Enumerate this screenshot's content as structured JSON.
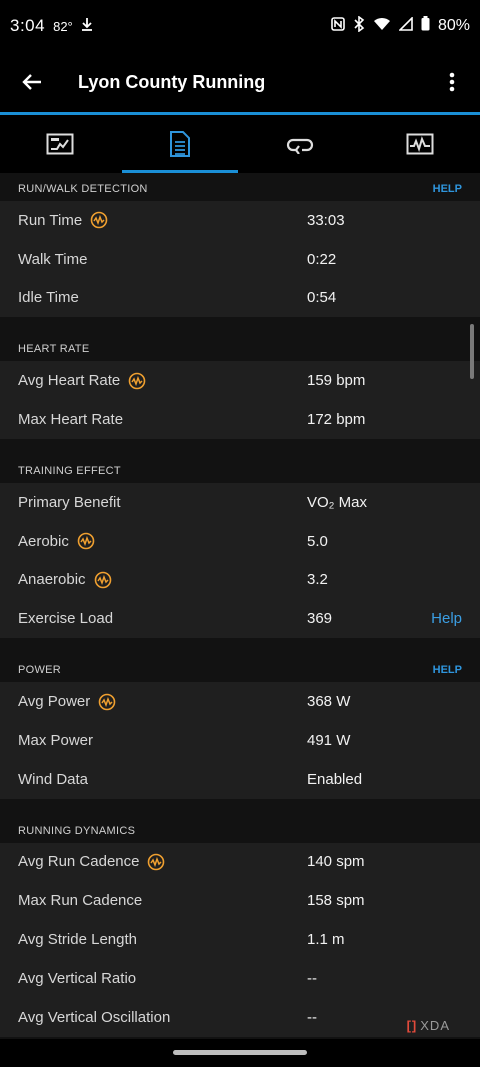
{
  "status_bar": {
    "time": "3:04",
    "temp": "82°",
    "battery": "80%"
  },
  "app_bar": {
    "title": "Lyon County Running"
  },
  "tabs": [
    {
      "icon": "summary-chart-icon"
    },
    {
      "icon": "stats-document-icon",
      "active": true
    },
    {
      "icon": "laps-loop-icon"
    },
    {
      "icon": "graphs-icon"
    }
  ],
  "sections": {
    "run_walk": {
      "title": "RUN/WALK DETECTION",
      "help": "HELP",
      "rows": [
        {
          "label": "Run Time",
          "value": "33:03"
        },
        {
          "label": "Walk Time",
          "value": "0:22"
        },
        {
          "label": "Idle Time",
          "value": "0:54"
        }
      ]
    },
    "heart_rate": {
      "title": "HEART RATE",
      "rows": [
        {
          "label": "Avg Heart Rate",
          "value": "159 bpm"
        },
        {
          "label": "Max Heart Rate",
          "value": "172 bpm"
        }
      ]
    },
    "training_effect": {
      "title": "TRAINING EFFECT",
      "rows": [
        {
          "label": "Primary Benefit",
          "value": "VO₂ Max"
        },
        {
          "label": "Aerobic",
          "value": "5.0"
        },
        {
          "label": "Anaerobic",
          "value": "3.2"
        },
        {
          "label": "Exercise Load",
          "value": "369",
          "help": "Help"
        }
      ]
    },
    "power": {
      "title": "POWER",
      "help": "HELP",
      "rows": [
        {
          "label": "Avg Power",
          "value": "368 W"
        },
        {
          "label": "Max Power",
          "value": "491 W"
        },
        {
          "label": "Wind Data",
          "value": "Enabled"
        }
      ]
    },
    "running_dynamics": {
      "title": "RUNNING DYNAMICS",
      "rows": [
        {
          "label": "Avg Run Cadence",
          "value": "140 spm"
        },
        {
          "label": "Max Run Cadence",
          "value": "158 spm"
        },
        {
          "label": "Avg Stride Length",
          "value": "1.1 m"
        },
        {
          "label": "Avg Vertical Ratio",
          "value": "--"
        },
        {
          "label": "Avg Vertical Oscillation",
          "value": "--"
        }
      ]
    }
  },
  "watermark": "XDA",
  "colors": {
    "accent": "#1a8fd6",
    "help": "#2f95dc",
    "icon_orange": "#f0a030"
  }
}
